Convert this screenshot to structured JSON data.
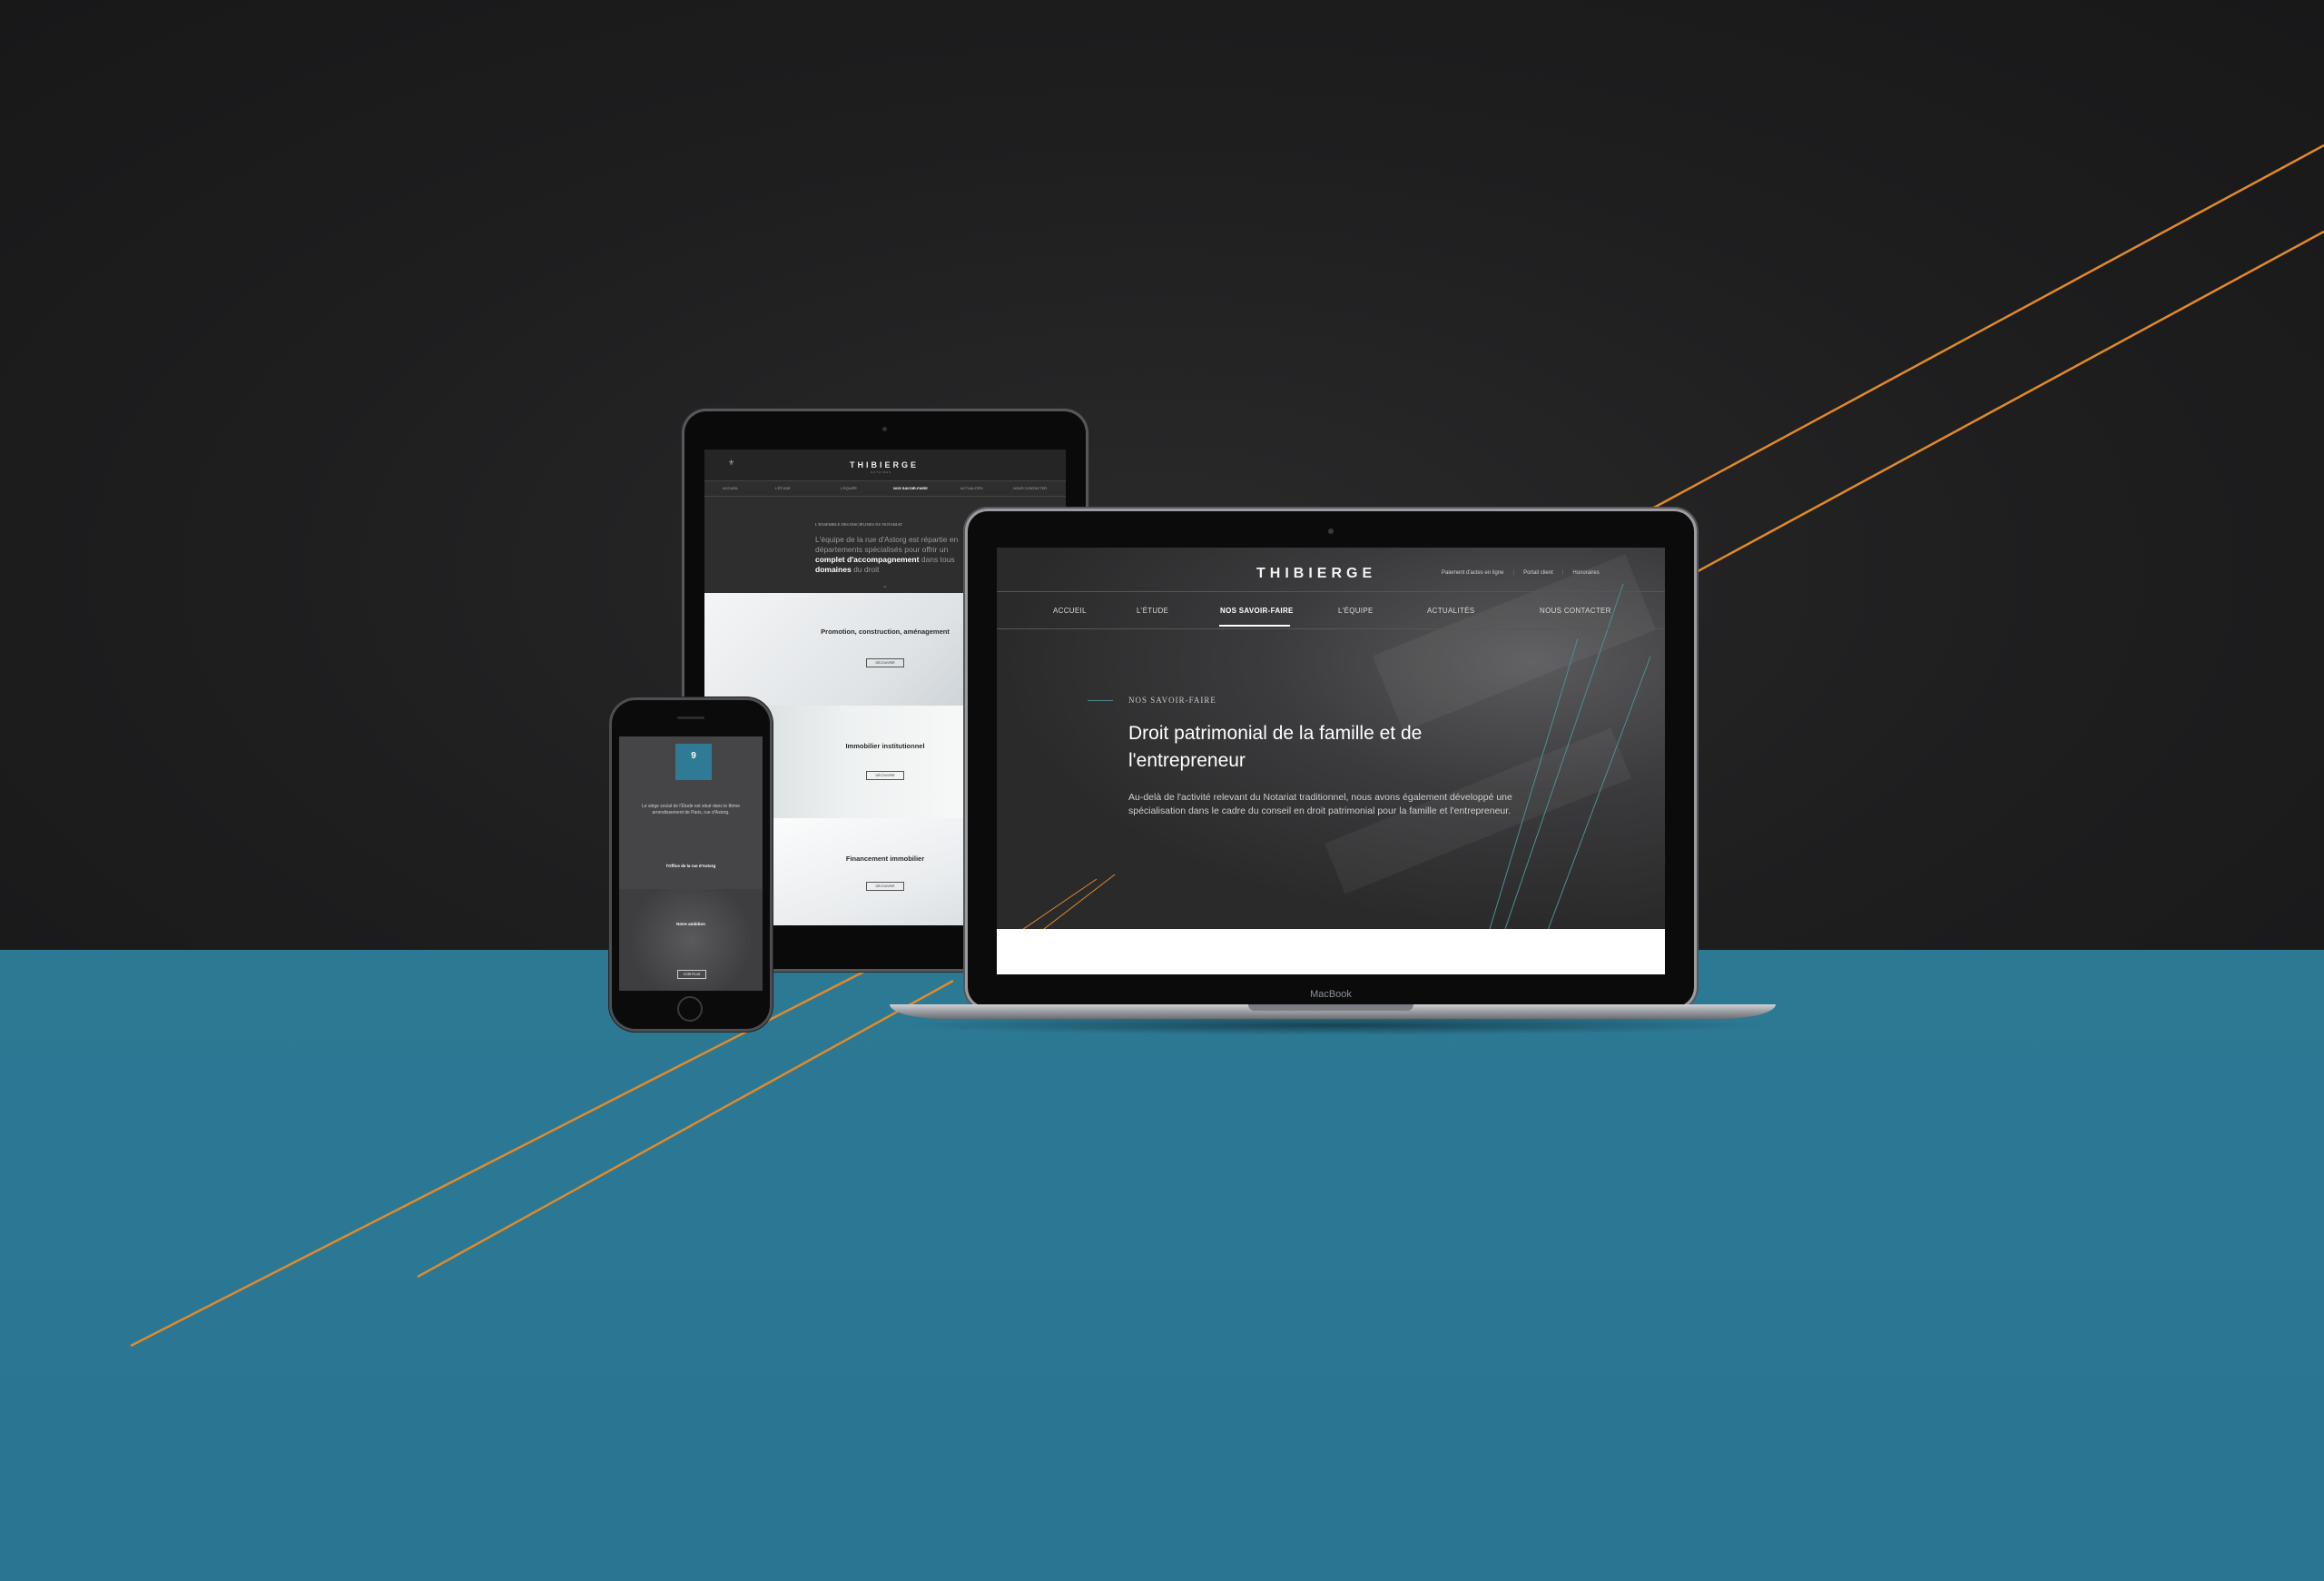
{
  "laptop": {
    "brand": "MacBook",
    "site": {
      "logo": "THIBIERGE",
      "top_links": [
        "Paiement d'actes en ligne",
        "Portail client",
        "Honoraires"
      ],
      "nav": [
        "ACCUEIL",
        "L'ÉTUDE",
        "NOS SAVOIR-FAIRE",
        "L'ÉQUIPE",
        "ACTUALITÉS",
        "NOUS CONTACTER"
      ],
      "active_nav": "NOS SAVOIR-FAIRE",
      "kicker": "NOS SAVOIR-FAIRE",
      "title": "Droit patrimonial de la famille et de l'entrepreneur",
      "body": "Au-delà de l'activité relevant du Notariat traditionnel, nous avons également développé une spécialisation dans le cadre du conseil en droit patrimonial pour la famille et l'entrepreneur."
    }
  },
  "tablet": {
    "site": {
      "logo": "THIBIERGE",
      "logo_sub": "NOTAIRES",
      "nav": [
        "ACCUEIL",
        "L'ÉTUDE",
        "NOS SAVOIR-FAIRE",
        "L'ÉQUIPE",
        "ACTUALITÉS",
        "NOUS CONTACTER"
      ],
      "active_nav": "NOS SAVOIR-FAIRE",
      "kicker": "L'ENSEMBLE DES DISCIPLINES DU NOTARIAT",
      "intro_lead": "L'équipe de la rue d'Astorg est répartie en départements spécialisés pour offrir un",
      "intro_bold": "complet d'accompagnement",
      "intro_mid": "dans tous",
      "intro_bold2": "domaines",
      "intro_end": "du droit",
      "sections": [
        {
          "title": "Promotion, construction, aménagement",
          "button": "DÉCOUVRIR"
        },
        {
          "title": "Immobilier institutionnel",
          "button": "DÉCOUVRIR"
        },
        {
          "title": "Financement immobilier",
          "button": "DÉCOUVRIR"
        }
      ]
    }
  },
  "phone": {
    "site": {
      "tile_number": "9",
      "intro": "Le siège social de l'Étude est situé dans le 8ème arrondissement de Paris, rue d'Astorg.",
      "team_bold": "l'Office de la rue d'Astorg",
      "crowd_title": "Notre ambition",
      "button": "VOIR PLUS"
    }
  },
  "colors": {
    "teal": "#2b7894",
    "accent_orange": "#e08a2c",
    "dark_bg": "#1e1e1f"
  }
}
